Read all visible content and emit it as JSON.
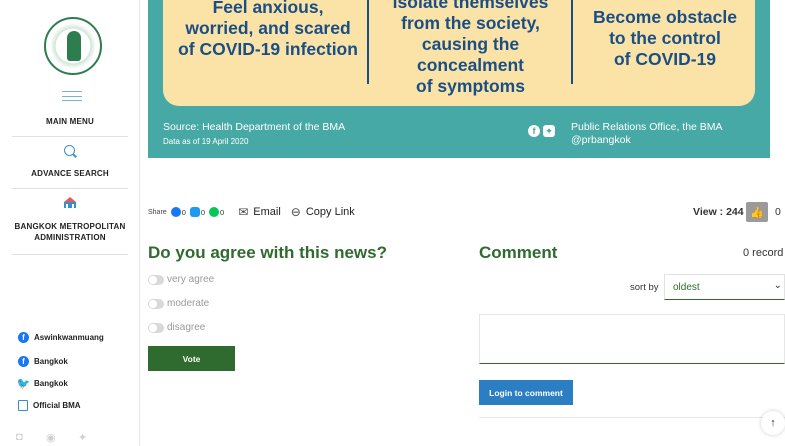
{
  "sidebar": {
    "main_menu": "MAIN MENU",
    "advance_search": "ADVANCE SEARCH",
    "bma_line1": "BANGKOK METROPOLITAN",
    "bma_line2": "ADMINISTRATION",
    "social": [
      {
        "icon": "facebook-icon",
        "label": "Aswinkwanmuang"
      },
      {
        "icon": "facebook-icon",
        "label": "Bangkok"
      },
      {
        "icon": "twitter-icon",
        "label": "Bangkok"
      },
      {
        "icon": "document-icon",
        "label": "Official BMA"
      }
    ]
  },
  "banner": {
    "col1": [
      "Feel anxious,",
      "worried, and scared",
      "of COVID-19 infection"
    ],
    "col2": [
      "isolate themselves",
      "from the society,",
      "causing the",
      "concealment",
      "of symptoms"
    ],
    "col3": [
      "Become obstacle",
      "to the control",
      "of COVID-19"
    ],
    "source": "Source: Health Department of the BMA",
    "data_date": "Data as of 19 April 2020",
    "pr_line1": "Public Relations Office, the BMA",
    "pr_line2": "@prbangkok"
  },
  "share": {
    "label": "Share",
    "facebook_count": "0",
    "twitter_count": "0",
    "line_count": "0",
    "email": "Email",
    "copy_link": "Copy Link",
    "view": "View : 244",
    "like_count": "0"
  },
  "poll": {
    "title": "Do you agree with this news?",
    "options": [
      "very agree",
      "moderate",
      "disagree"
    ],
    "vote": "Vote"
  },
  "comment": {
    "title": "Comment",
    "record_count": "0 record",
    "sort_label": "sort by",
    "sort_value": "oldest",
    "login_button": "Login to comment"
  },
  "colors": {
    "teal": "#47a9a6",
    "cream": "#fbe2a7",
    "navy": "#1a4f85",
    "green": "#2f6b2f",
    "blue": "#2b7ec2"
  }
}
